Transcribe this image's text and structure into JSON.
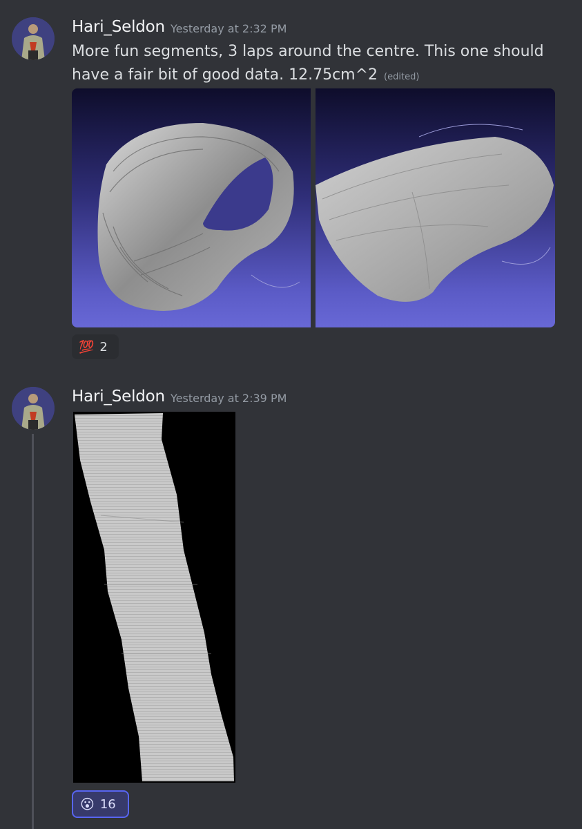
{
  "messages": [
    {
      "author": "Hari_Seldon",
      "timestamp": "Yesterday at 2:32 PM",
      "text": "More fun segments, 3 laps around the centre. This one should have a fair bit of good data. 12.75cm^2",
      "edited_label": "(edited)",
      "reaction": {
        "emoji": "💯",
        "emoji_name": "hundred-points-icon",
        "count": "2"
      }
    },
    {
      "author": "Hari_Seldon",
      "timestamp": "Yesterday at 2:39 PM",
      "reaction": {
        "emoji": "😮",
        "emoji_name": "surprised-face-icon",
        "count": "16"
      }
    }
  ],
  "colors": {
    "background": "#313338",
    "accent": "#5865f2",
    "username": "#f2f3f5",
    "muted": "#949ba4"
  }
}
